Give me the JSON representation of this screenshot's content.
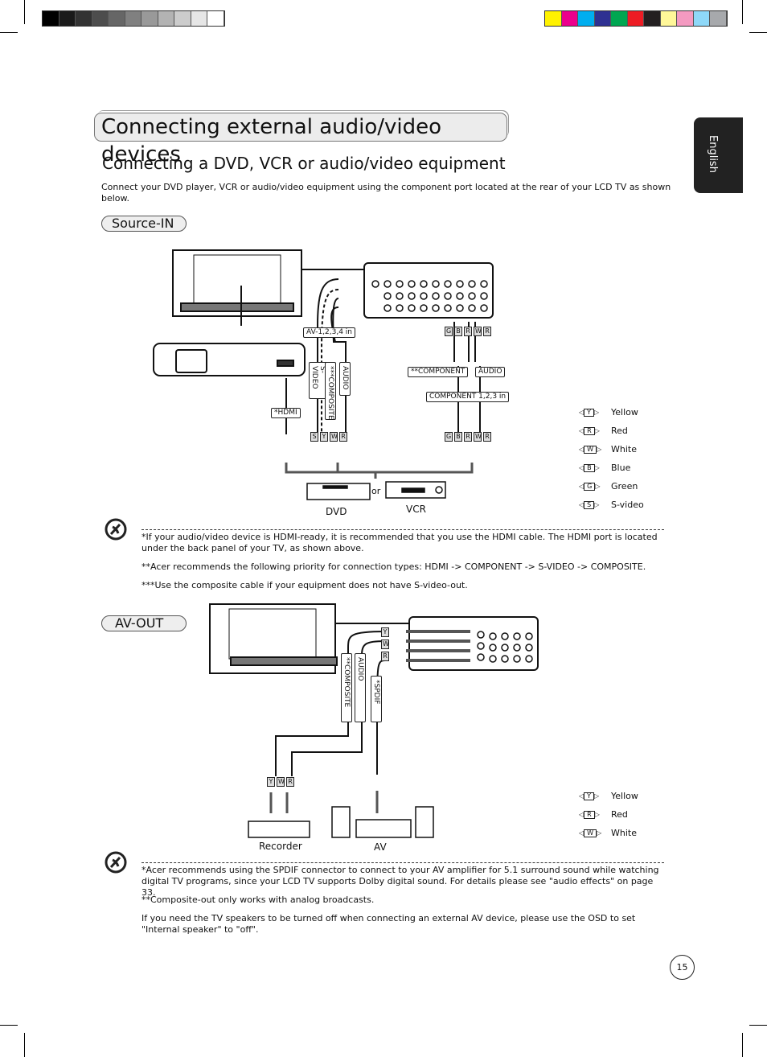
{
  "print_marks": {
    "gray_swatches": [
      "#000000",
      "#1a1a1a",
      "#333333",
      "#4d4d4d",
      "#666666",
      "#808080",
      "#999999",
      "#b3b3b3",
      "#cccccc",
      "#e6e6e6",
      "#ffffff"
    ],
    "color_swatches": [
      "#fff200",
      "#ec008c",
      "#00aeef",
      "#2e3192",
      "#00a651",
      "#ed1c24",
      "#231f20",
      "#fff799",
      "#f49ac1",
      "#8ed8f8",
      "#a7a9ac"
    ]
  },
  "header": {
    "title": "Connecting external audio/video devices",
    "subtitle": "Connecting a DVD, VCR or audio/video equipment",
    "intro": "Connect your DVD player, VCR or audio/video equipment using the component port located at the rear of your LCD TV as shown below."
  },
  "language_tab": "English",
  "source_in": {
    "label": "Source-IN",
    "diagram": {
      "av_in": "AV-1,2,3,4 in",
      "svideo": "S-VIDEO",
      "composite": "***COMPOSITE",
      "audio": "AUDIO",
      "hdmi": "*HDMI",
      "component": "**COMPONENT",
      "comp_audio": "AUDIO",
      "component_in": "COMPONENT 1,2,3 in",
      "or": "or",
      "dvd": "DVD",
      "vcr": "VCR",
      "plugs_top": [
        "S",
        "Y",
        "W",
        "R"
      ],
      "plugs_bottom": [
        "S",
        "Y",
        "W",
        "R"
      ],
      "comp_plugs": [
        "G",
        "B",
        "R",
        "W",
        "R"
      ]
    },
    "legend": [
      {
        "code": "Y",
        "name": "Yellow"
      },
      {
        "code": "R",
        "name": "Red"
      },
      {
        "code": "W",
        "name": "White"
      },
      {
        "code": "B",
        "name": "Blue"
      },
      {
        "code": "G",
        "name": "Green"
      },
      {
        "code": "S",
        "name": "S-video"
      }
    ],
    "notes": [
      "*If your audio/video device is HDMI-ready, it is recommended that you use the HDMI cable. The HDMI port is located under the back panel of your TV, as shown above.",
      "**Acer recommends the following priority for connection types: HDMI -> COMPONENT -> S-VIDEO -> COMPOSITE.",
      "***Use the composite cable if your equipment does not have S-video-out."
    ]
  },
  "av_out": {
    "label": "AV-OUT",
    "diagram": {
      "composite": "**COMPOSITE",
      "audio": "AUDIO",
      "spdif": "*SPDIF",
      "recorder": "Recorder",
      "av": "AV",
      "plugs": [
        "Y",
        "W",
        "R"
      ]
    },
    "legend": [
      {
        "code": "Y",
        "name": "Yellow"
      },
      {
        "code": "R",
        "name": "Red"
      },
      {
        "code": "W",
        "name": "White"
      }
    ],
    "notes": [
      "*Acer recommends using the SPDIF connector to connect to your AV amplifier for 5.1 surround sound while watching digital TV programs, since your LCD TV supports Dolby digital sound. For details please see \"audio effects\" on page 33.",
      "**Composite-out only works with analog broadcasts.",
      "If you need the TV speakers to be turned off when connecting an external AV device, please use the OSD to set \"Internal speaker\" to \"off\"."
    ]
  },
  "page_number": "15"
}
